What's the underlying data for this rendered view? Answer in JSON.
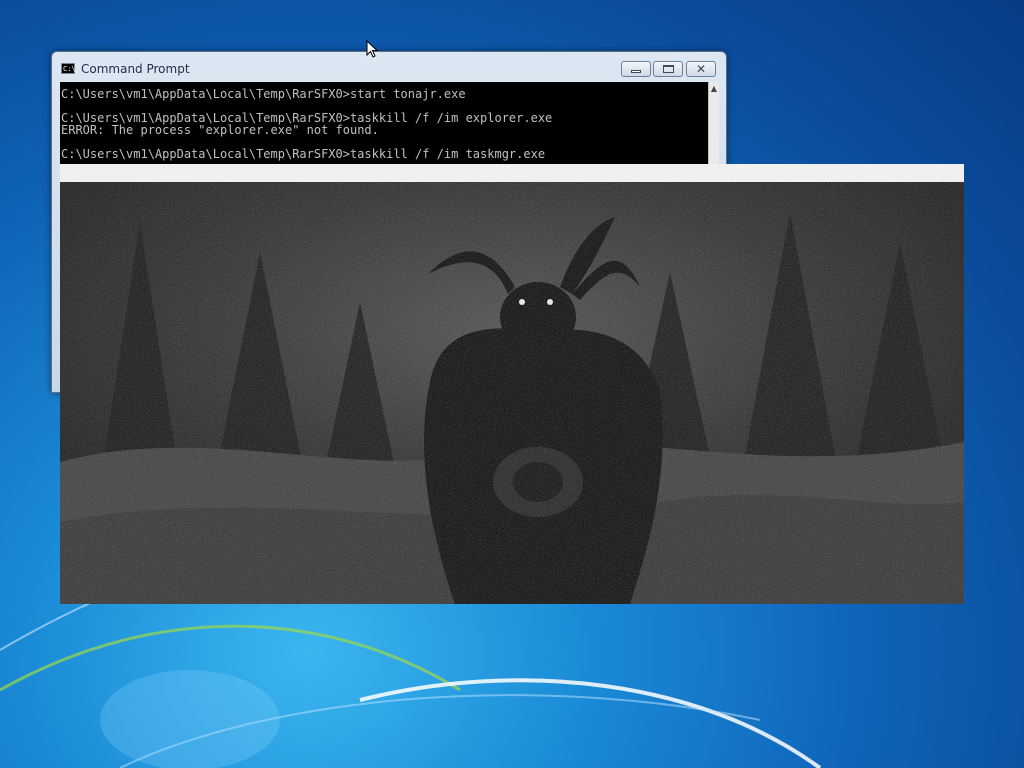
{
  "desktop": {
    "theme_colors": {
      "sky_top": "#0a4a98",
      "sky_bottom": "#3bb6ef",
      "swirl": "#ffffff"
    }
  },
  "cmd_window": {
    "title": "Command Prompt",
    "icon": "cmd-icon",
    "icon_text": "C:\\",
    "controls": {
      "minimize": "minimize-icon",
      "maximize": "maximize-icon",
      "close": "close-icon",
      "close_glyph": "✕"
    },
    "console_lines": [
      "C:\\Users\\vm1\\AppData\\Local\\Temp\\RarSFX0>start tonajr.exe",
      "",
      "C:\\Users\\vm1\\AppData\\Local\\Temp\\RarSFX0>taskkill /f /im explorer.exe",
      "ERROR: The process \"explorer.exe\" not found.",
      "",
      "C:\\Users\\vm1\\AppData\\Local\\Temp\\RarSFX0>taskkill /f /im taskmgr.exe"
    ],
    "scroll_up_glyph": "▲",
    "colors": {
      "console_bg": "#000000",
      "console_text": "#c0c0c0"
    }
  },
  "image_window": {
    "image": "dark-horned-creature-in-forest",
    "colors": {
      "header": "#f0f0f0",
      "scene": "#1c1c1c"
    }
  },
  "cursor": {
    "icon": "arrow-cursor-icon"
  }
}
